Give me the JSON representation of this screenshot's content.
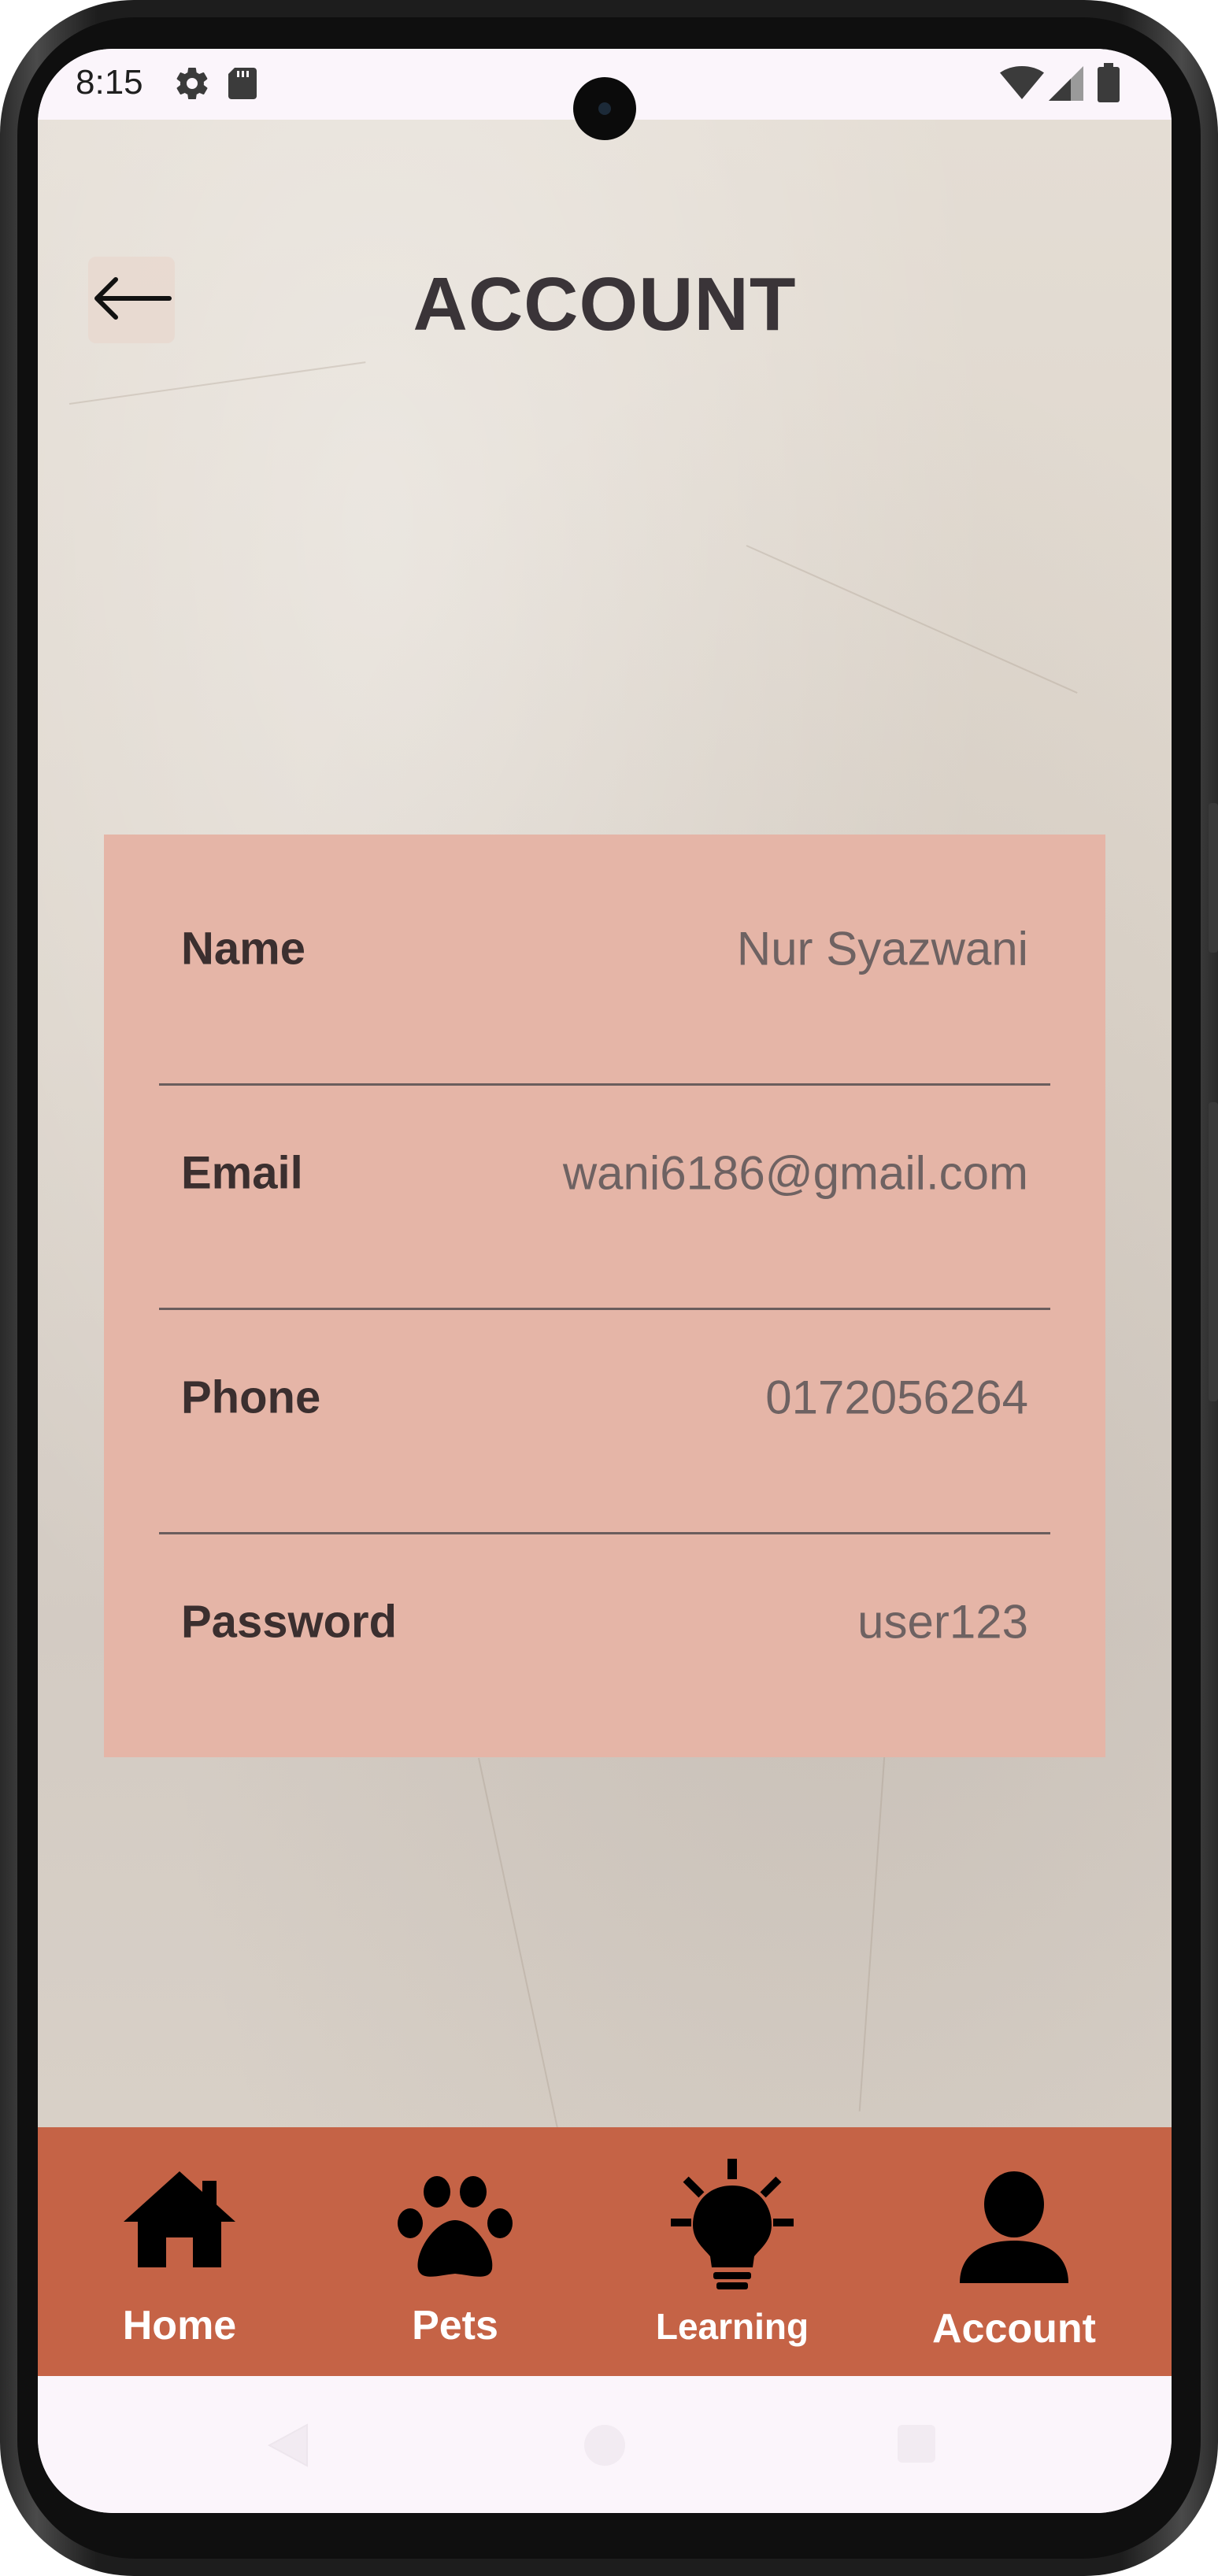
{
  "status_bar": {
    "time": "8:15",
    "icons": [
      "settings-gear-icon",
      "sd-card-icon",
      "wifi-icon",
      "cellular-signal-icon",
      "battery-icon"
    ]
  },
  "header": {
    "back_icon": "arrow-left-icon",
    "title": "ACCOUNT"
  },
  "account": {
    "fields": [
      {
        "label": "Name",
        "value": "Nur Syazwani"
      },
      {
        "label": "Email",
        "value": "wani6186@gmail.com"
      },
      {
        "label": "Phone",
        "value": "0172056264"
      },
      {
        "label": "Password",
        "value": "user123"
      }
    ]
  },
  "bottom_nav": {
    "items": [
      {
        "label": "Home",
        "icon": "home-icon"
      },
      {
        "label": "Pets",
        "icon": "paw-icon"
      },
      {
        "label": "Learning",
        "icon": "lightbulb-icon"
      },
      {
        "label": "Account",
        "icon": "person-icon"
      }
    ]
  },
  "system_nav": {
    "icons": [
      "back-triangle-icon",
      "home-circle-icon",
      "recents-square-icon"
    ]
  },
  "colors": {
    "card_background": "#e5b5a7",
    "nav_background": "#c56346",
    "title_text": "#3a3438",
    "label_text": "#3b2f2f",
    "value_text": "#6e6262"
  }
}
